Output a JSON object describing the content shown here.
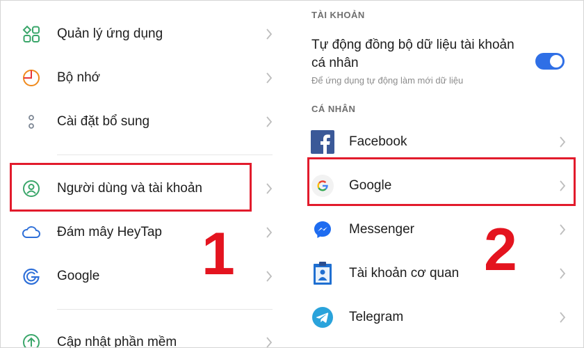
{
  "left_panel": {
    "items": [
      {
        "label": "Quản lý ứng dụng",
        "icon": "app-grid-icon"
      },
      {
        "label": "Bộ nhớ",
        "icon": "storage-pie-icon"
      },
      {
        "label": "Cài đặt bổ sung",
        "icon": "additional-settings-icon"
      },
      {
        "label": "Người dùng và tài khoản",
        "icon": "user-account-icon"
      },
      {
        "label": "Đám mây HeyTap",
        "icon": "cloud-icon"
      },
      {
        "label": "Google",
        "icon": "google-g-icon"
      },
      {
        "label": "Cập nhật phần mềm",
        "icon": "software-update-icon"
      }
    ],
    "step_label": "1"
  },
  "right_panel": {
    "section_account": "TÀI KHOẢN",
    "sync": {
      "title": "Tự động đồng bộ dữ liệu tài khoản cá nhân",
      "subtitle": "Để ứng dụng tự động làm mới dữ liệu",
      "enabled": true
    },
    "section_personal": "CÁ NHÂN",
    "items": [
      {
        "label": "Facebook",
        "icon": "facebook-icon"
      },
      {
        "label": "Google",
        "icon": "google-icon"
      },
      {
        "label": "Messenger",
        "icon": "messenger-icon"
      },
      {
        "label": "Tài khoản cơ quan",
        "icon": "work-account-icon"
      },
      {
        "label": "Telegram",
        "icon": "telegram-icon"
      }
    ],
    "step_label": "2"
  },
  "colors": {
    "highlight": "#e21b2c",
    "toggle": "#2f6fe6",
    "icon_green": "#3aa66a",
    "facebook": "#3b5998",
    "telegram": "#2aa3db",
    "messenger": "#1e6cf0"
  }
}
